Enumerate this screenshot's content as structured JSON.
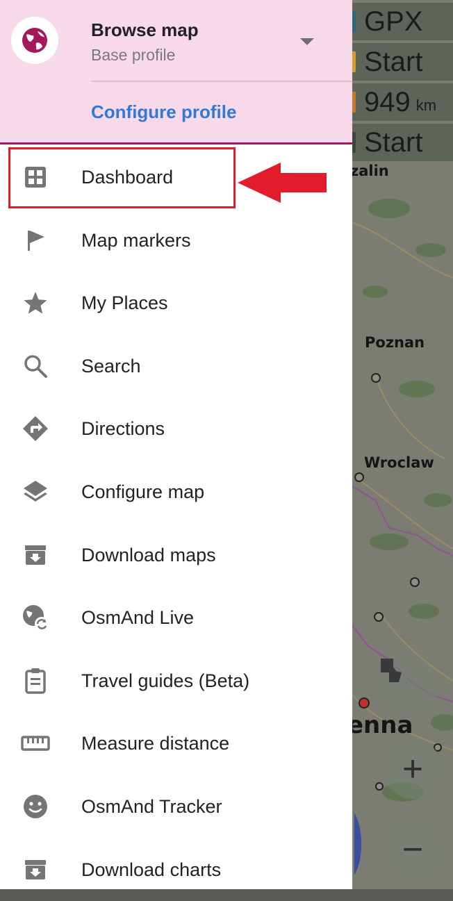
{
  "map": {
    "widgets": [
      {
        "value": "GPX",
        "unit": "",
        "icon": "gpx-icon"
      },
      {
        "value": "Start",
        "unit": "",
        "icon": "clock-icon"
      },
      {
        "value": "949",
        "unit": "km",
        "icon": "distance-icon"
      },
      {
        "value": "Start",
        "unit": "",
        "icon": "time-icon"
      }
    ],
    "cities": [
      "zalin",
      "Poznan",
      "Wroclaw",
      "enna"
    ],
    "buttons": {
      "zoom_in": "+",
      "zoom_out": "−"
    }
  },
  "profile": {
    "title": "Browse map",
    "subtitle": "Base profile",
    "configure_label": "Configure profile",
    "icon": "globe-icon",
    "accent": "#a3195b"
  },
  "menu": {
    "items": [
      {
        "label": "Dashboard",
        "icon": "dashboard-icon"
      },
      {
        "label": "Map markers",
        "icon": "flag-icon"
      },
      {
        "label": "My Places",
        "icon": "star-icon"
      },
      {
        "label": "Search",
        "icon": "search-icon"
      },
      {
        "label": "Directions",
        "icon": "directions-icon"
      },
      {
        "label": "Configure map",
        "icon": "layers-icon"
      },
      {
        "label": "Download maps",
        "icon": "download-icon"
      },
      {
        "label": "OsmAnd Live",
        "icon": "globe-refresh-icon"
      },
      {
        "label": "Travel guides (Beta)",
        "icon": "clipboard-icon"
      },
      {
        "label": "Measure distance",
        "icon": "ruler-icon"
      },
      {
        "label": "OsmAnd Tracker",
        "icon": "smiley-icon"
      },
      {
        "label": "Download charts",
        "icon": "download-icon"
      }
    ]
  },
  "annotation": {
    "highlight_color": "#e31c2b"
  }
}
